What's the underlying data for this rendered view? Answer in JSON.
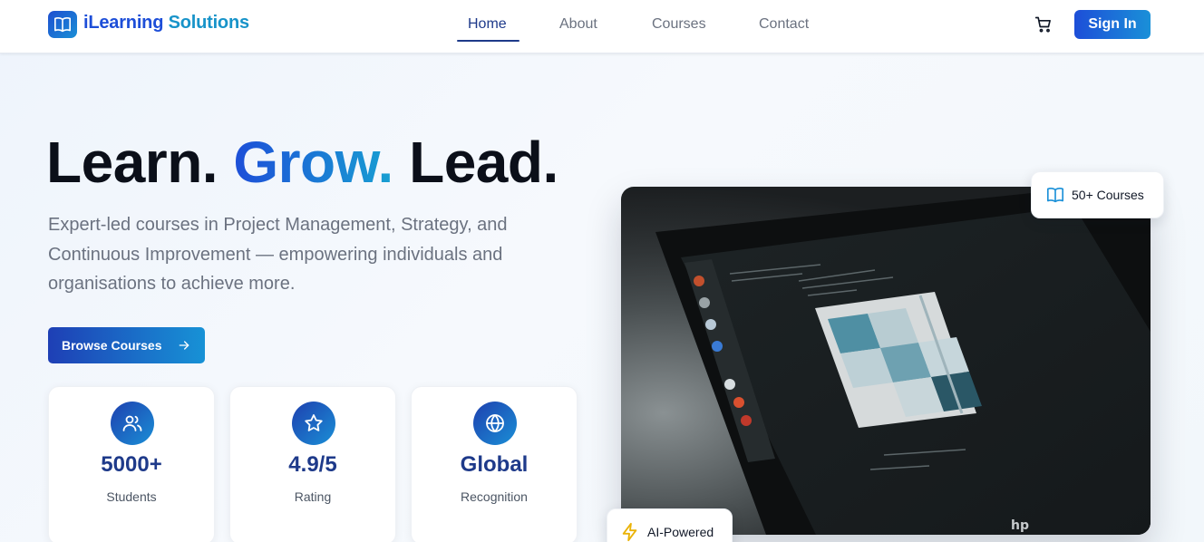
{
  "brand": {
    "part1": "iLearning",
    "part2": "Solutions"
  },
  "nav": {
    "items": [
      {
        "label": "Home",
        "active": true
      },
      {
        "label": "About",
        "active": false
      },
      {
        "label": "Courses",
        "active": false
      },
      {
        "label": "Contact",
        "active": false
      }
    ],
    "signin_label": "Sign In",
    "cart_icon": "shopping-cart-icon"
  },
  "hero": {
    "title_part1": "Learn.",
    "title_part2": "Grow.",
    "title_part3": "Lead.",
    "subtitle": "Expert-led courses in Project Management, Strategy, and Continuous Improvement — empowering individuals and organisations to achieve more.",
    "cta_label": "Browse Courses"
  },
  "stats": [
    {
      "icon": "users-icon",
      "value": "5000+",
      "label": "Students"
    },
    {
      "icon": "star-icon",
      "value": "4.9/5",
      "label": "Rating"
    },
    {
      "icon": "globe-icon",
      "value": "Global",
      "label": "Recognition"
    }
  ],
  "badges": {
    "courses": "50+ Courses",
    "ai": "AI-Powered"
  },
  "colors": {
    "primary": "#1d4ed8",
    "accent": "#1a90d8",
    "heading_dark": "#1e3a8a",
    "ai_bolt": "#eab308"
  }
}
